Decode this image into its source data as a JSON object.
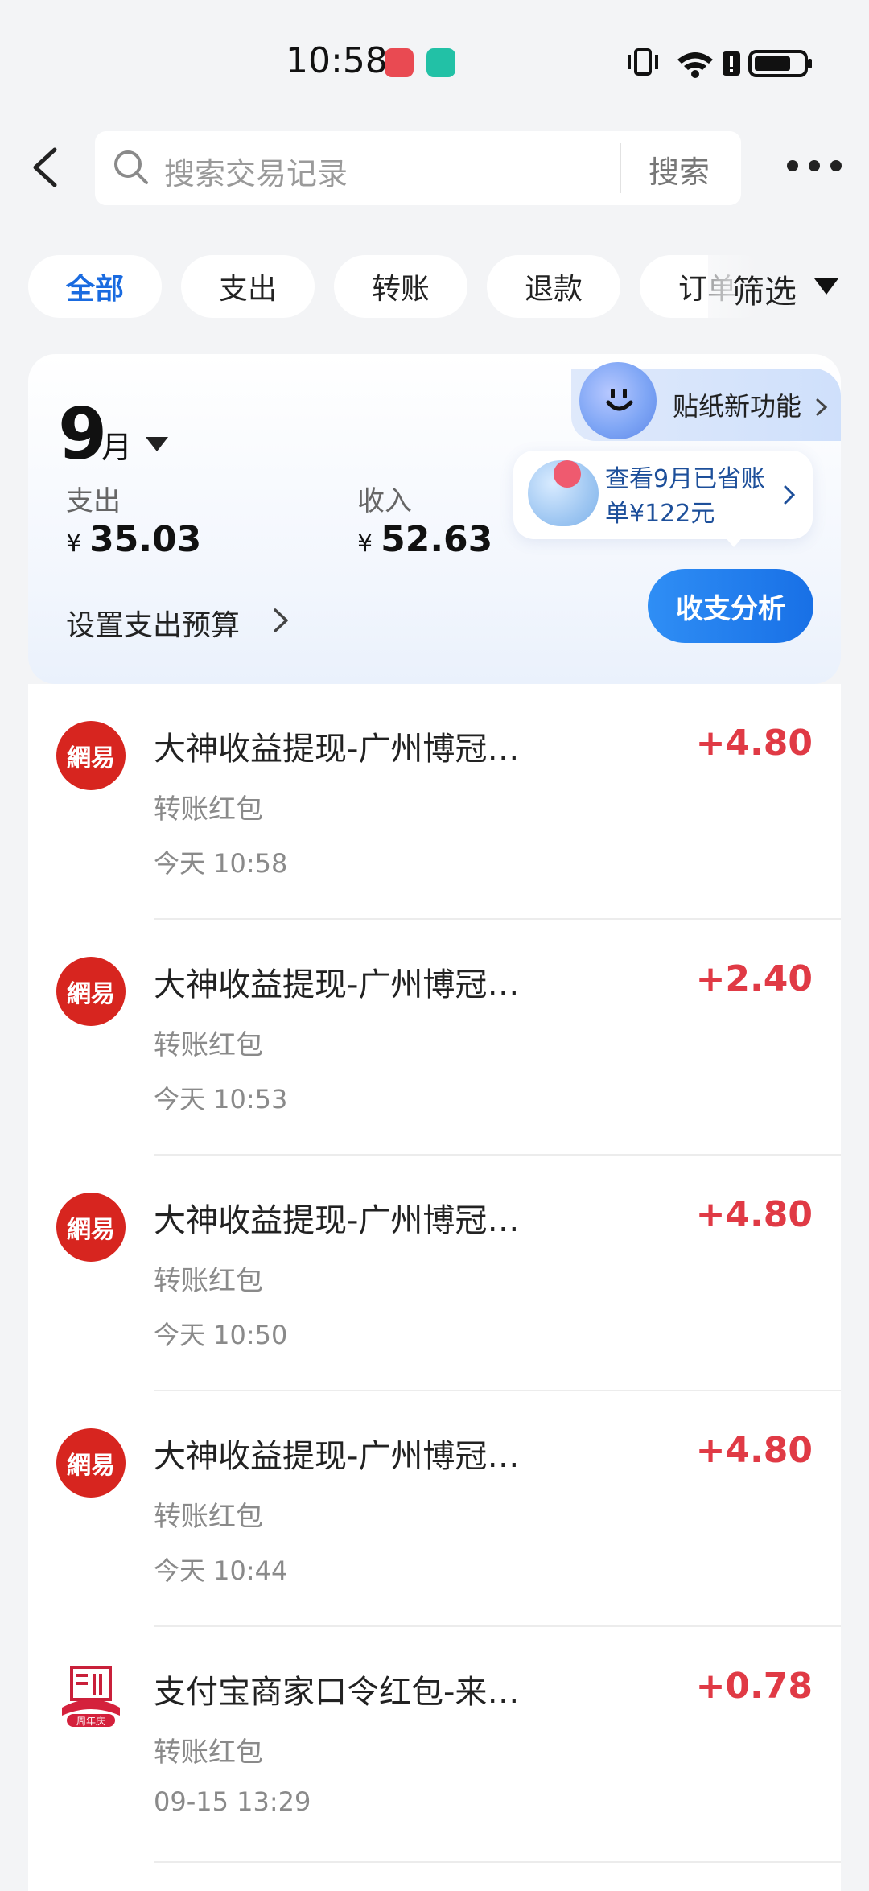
{
  "status_bar": {
    "time": "10:58",
    "icons": [
      "vibrate-icon",
      "wifi-icon",
      "alert-icon",
      "battery-icon"
    ]
  },
  "top_bar": {
    "search_placeholder": "搜索交易记录",
    "search_button": "搜索"
  },
  "filters": {
    "chips": [
      "全部",
      "支出",
      "转账",
      "退款",
      "订单"
    ],
    "active": "全部",
    "filter_label": "筛选"
  },
  "summary": {
    "month": "9",
    "month_unit": "月",
    "expense_label": "支出",
    "expense_value": "35.03",
    "income_label": "收入",
    "income_value": "52.63",
    "currency": "¥",
    "budget_label": "设置支出预算",
    "sticker_label": "贴纸新功能",
    "tip_text": "查看9月已省账单¥122元",
    "analysis_button": "收支分析"
  },
  "transactions": [
    {
      "title": "大神收益提现-广州博冠信息科技有...",
      "category": "转账红包",
      "time": "今天 10:58",
      "amount": "+4.80",
      "logo": "網易"
    },
    {
      "title": "大神收益提现-广州博冠信息科技有...",
      "category": "转账红包",
      "time": "今天 10:53",
      "amount": "+2.40",
      "logo": "網易"
    },
    {
      "title": "大神收益提现-广州博冠信息科技有...",
      "category": "转账红包",
      "time": "今天 10:50",
      "amount": "+4.80",
      "logo": "網易"
    },
    {
      "title": "大神收益提现-广州博冠信息科技有...",
      "category": "转账红包",
      "time": "今天 10:44",
      "amount": "+4.80",
      "logo": "網易"
    },
    {
      "title": "支付宝商家口令红包-来自中免日上",
      "category": "转账红包",
      "time": "09-15 13:29",
      "amount": "+0.78",
      "logo": "周年庆"
    }
  ],
  "colors": {
    "accent": "#1a6be0",
    "income_amount": "#e03a45",
    "netease_red": "#d7251f"
  }
}
